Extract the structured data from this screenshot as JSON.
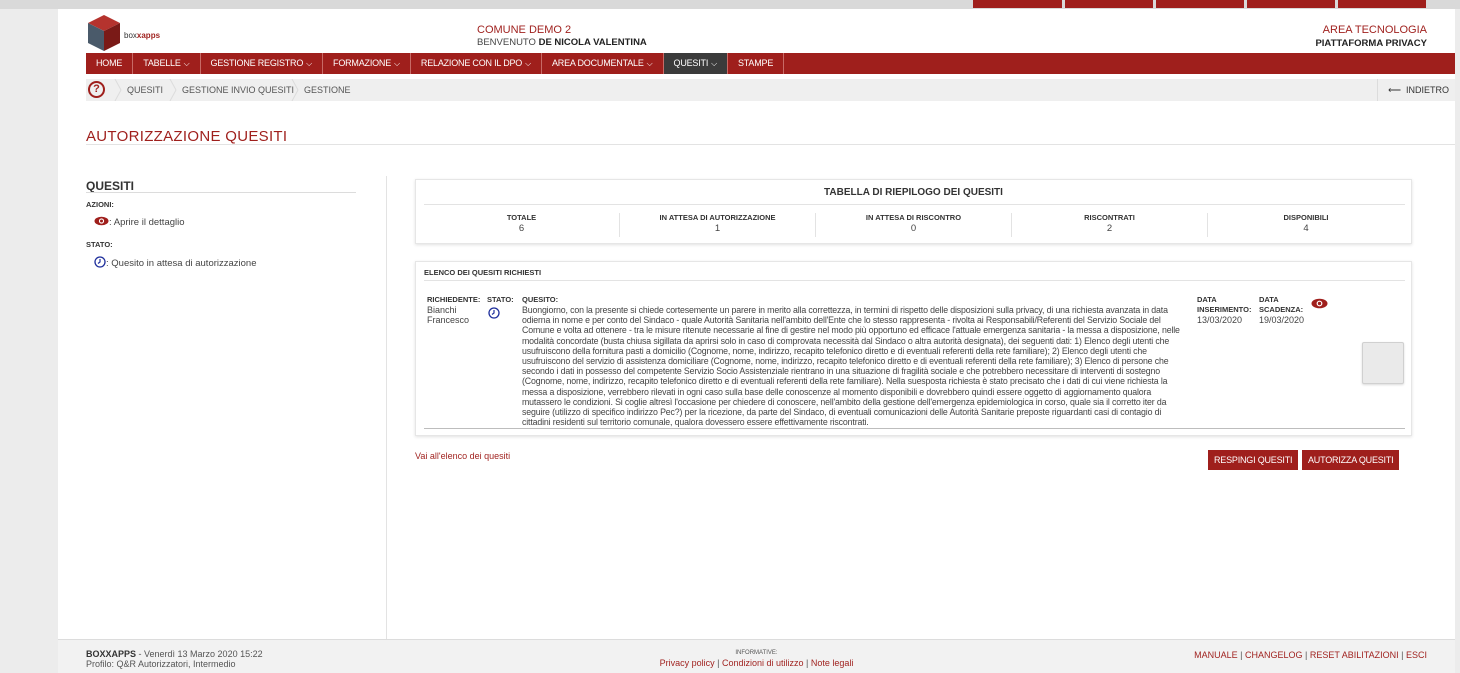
{
  "header": {
    "logo_text_a": "box",
    "logo_text_b": "xapps",
    "comune": "COMUNE DEMO 2",
    "welcome_label": "BENVENUTO",
    "welcome_user": "DE NICOLA VALENTINA",
    "area": "AREA TECNOLOGIA",
    "platform": "PIATTAFORMA PRIVACY"
  },
  "nav": {
    "items": [
      {
        "label": "HOME"
      },
      {
        "label": "TABELLE"
      },
      {
        "label": "GESTIONE REGISTRO"
      },
      {
        "label": "FORMAZIONE"
      },
      {
        "label": "RELAZIONE CON IL DPO"
      },
      {
        "label": "AREA DOCUMENTALE"
      },
      {
        "label": "QUESITI"
      },
      {
        "label": "STAMPE"
      }
    ]
  },
  "breadcrumb": {
    "items": [
      "QUESITI",
      "GESTIONE INVIO QUESITI",
      "GESTIONE"
    ],
    "back_label": "INDIETRO"
  },
  "page": {
    "title": "AUTORIZZAZIONE QUESITI"
  },
  "legend": {
    "title": "QUESITI",
    "actions_label": "AZIONI:",
    "action_detail": ": Aprire il dettaglio",
    "status_label": "STATO:",
    "status_waiting": ": Quesito in attesa di autorizzazione"
  },
  "summary": {
    "title": "TABELLA DI RIEPILOGO DEI QUESITI",
    "columns": [
      {
        "label": "TOTALE",
        "value": "6"
      },
      {
        "label": "IN ATTESA DI AUTORIZZAZIONE",
        "value": "1"
      },
      {
        "label": "IN ATTESA DI RISCONTRO",
        "value": "0"
      },
      {
        "label": "RISCONTRATI",
        "value": "2"
      },
      {
        "label": "DISPONIBILI",
        "value": "4"
      }
    ]
  },
  "list": {
    "title": "ELENCO DEI QUESITI RICHIESTI",
    "row": {
      "requester_label": "RICHIEDENTE:",
      "requester_first": "Bianchi",
      "requester_second": "Francesco",
      "status_label": "STATO:",
      "question_label": "QUESITO:",
      "question": "Buongiorno, con la presente si chiede cortesemente un parere in merito alla correttezza, in termini di rispetto delle disposizioni sulla privacy, di una richiesta avanzata in data odierna in nome e per conto del Sindaco - quale Autorità Sanitaria nell'ambito dell'Ente che lo stesso rappresenta - rivolta ai Responsabili/Referenti del Servizio Sociale del Comune e volta ad ottenere - tra le misure ritenute necessarie al fine di gestire nel modo più opportuno ed efficace l'attuale emergenza sanitaria - la messa a disposizione, nelle modalità concordate (busta chiusa sigillata da aprirsi solo in caso di comprovata necessità dal Sindaco o altra autorità designata), dei seguenti dati: 1) Elenco degli utenti che usufruiscono della fornitura pasti a domicilio (Cognome, nome, indirizzo, recapito telefonico diretto e di eventuali referenti della rete familiare); 2) Elenco degli utenti che usufruiscono del servizio di assistenza domiciliare (Cognome, nome, indirizzo, recapito telefonico diretto e di eventuali referenti della rete familiare); 3) Elenco di persone che secondo i dati in possesso del competente Servizio Socio Assistenziale rientrano in una situazione di fragilità sociale e che potrebbero necessitare di interventi di sostegno (Cognome, nome, indirizzo, recapito telefonico diretto e di eventuali referenti della rete familiare). Nella suesposta richiesta è stato precisato che i dati di cui viene richiesta la messa a disposizione, verrebbero rilevati in ogni caso sulla base delle conoscenze al momento disponibili e dovrebbero quindi essere oggetto di aggiornamento qualora mutassero le condizioni. Si coglie altresì l'occasione per chiedere di conoscere, nell'ambito della gestione dell'emergenza epidemiologica in corso, quale sia il corretto iter da seguire (utilizzo di specifico indirizzo Pec?) per la ricezione, da parte del Sindaco, di eventuali comunicazioni delle Autorità Sanitarie preposte riguardanti casi di contagio di cittadini residenti sul territorio comunale, qualora dovessero essere effettivamente riscontrati.",
      "insert_label_1": "DATA",
      "insert_label_2": "INSERIMENTO:",
      "insert_date": "13/03/2020",
      "expiry_label_1": "DATA",
      "expiry_label_2": "SCADENZA:",
      "expiry_date": "19/03/2020"
    },
    "link_all": "Vai all'elenco dei quesiti",
    "reject_label": "RESPINGI QUESITI",
    "authorize_label": "AUTORIZZA QUESITI"
  },
  "footer": {
    "brand": "BOXXAPPS",
    "datetime": " - Venerdì 13 Marzo 2020 15:22",
    "profile": "Profilo: Q&R Autorizzatori, Intermedio",
    "info_label": "INFORMATIVE:",
    "privacy": "Privacy policy",
    "terms": "Condizioni di utilizzo",
    "legal": "Note legali",
    "manual": "MANUALE",
    "changelog": "CHANGELOG",
    "reset": "RESET ABILITAZIONI",
    "exit": "ESCI"
  },
  "colors": {
    "accent": "#9f1f1c",
    "status_icon": "#1f2f9c",
    "nav_active": "#3b3b3b"
  }
}
